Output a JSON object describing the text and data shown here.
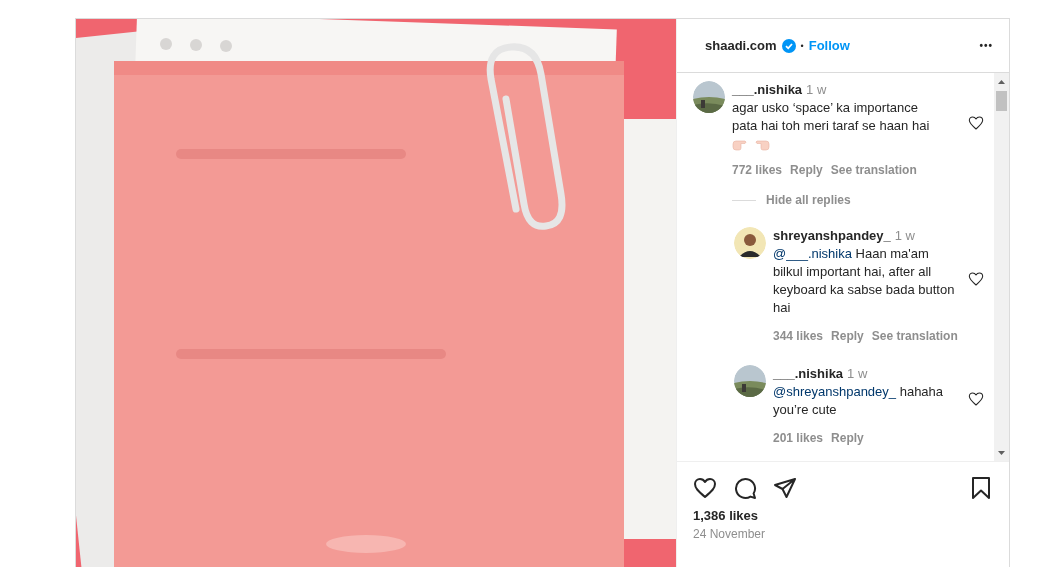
{
  "post": {
    "header": {
      "account": "shaadi.com",
      "verified": true,
      "separator": "•",
      "follow": "Follow",
      "more": "•••"
    },
    "comments": [
      {
        "user": "___.nishika",
        "time": "1 w",
        "text": "agar usko ‘space’ ka importance pata hai toh meri taraf se haan hai",
        "emojis": [
          {
            "kind": "point-right"
          },
          {
            "kind": "point-left"
          }
        ],
        "likes": "772 likes",
        "reply": "Reply",
        "translation": "See translation",
        "liked": false,
        "replies_toggle": "Hide all replies",
        "children": [
          {
            "user": "shreyanshpandey_",
            "time": "1 w",
            "mention": "@___.nishika",
            "text": "Haan ma'am bilkul important hai, after all keyboard ka sabse bada button hai",
            "likes": "344 likes",
            "reply": "Reply",
            "translation": "See translation",
            "liked": false
          },
          {
            "user": "___.nishika",
            "time": "1 w",
            "mention": "@shreyanshpandey_",
            "text": "hahaha you’re cute",
            "likes": "201 likes",
            "reply": "Reply",
            "liked": false
          }
        ]
      }
    ],
    "actions": {
      "liked": false,
      "saved": false
    },
    "likes": "1,386 likes",
    "date": "24 November"
  }
}
